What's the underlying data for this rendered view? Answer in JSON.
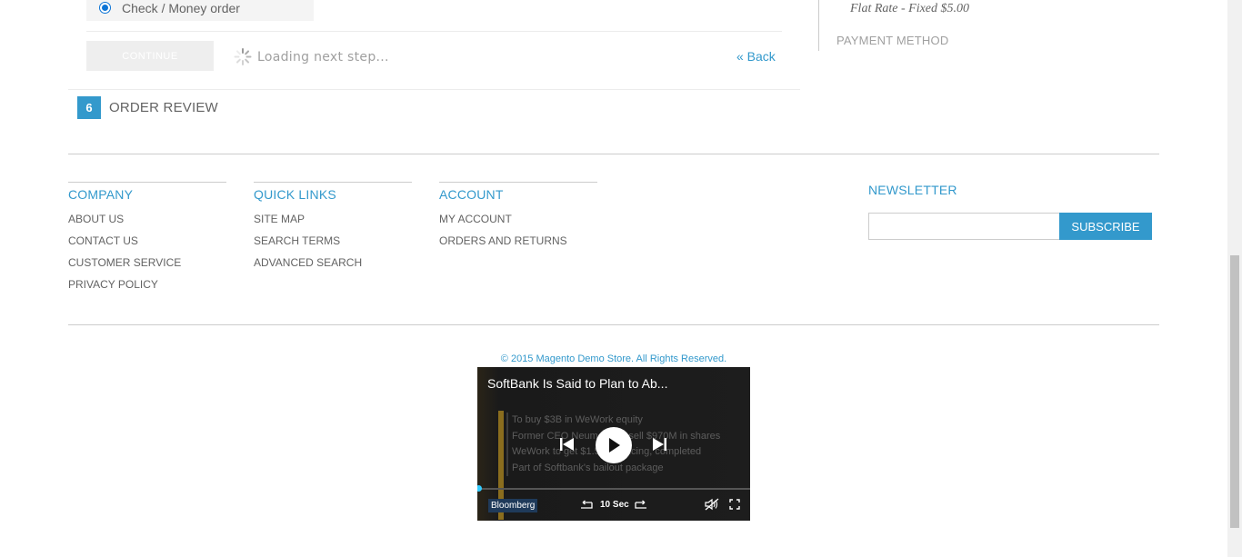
{
  "checkout": {
    "payment_option_label": "Check / Money order",
    "continue_label": "CONTINUE",
    "loading_text": "Loading next step...",
    "back_label": "« Back",
    "step_number": "6",
    "step_title": "ORDER REVIEW"
  },
  "sidebar": {
    "shipping_rate": "Flat Rate - Fixed $5.00",
    "payment_method_heading": "PAYMENT METHOD"
  },
  "footer": {
    "company": {
      "heading": "COMPANY",
      "links": [
        "ABOUT US",
        "CONTACT US",
        "CUSTOMER SERVICE",
        "PRIVACY POLICY"
      ]
    },
    "quick_links": {
      "heading": "QUICK LINKS",
      "links": [
        "SITE MAP",
        "SEARCH TERMS",
        "ADVANCED SEARCH"
      ]
    },
    "account": {
      "heading": "ACCOUNT",
      "links": [
        "MY ACCOUNT",
        "ORDERS AND RETURNS"
      ]
    },
    "newsletter": {
      "heading": "NEWSLETTER",
      "input_value": "",
      "subscribe_label": "SUBSCRIBE"
    },
    "copyright": "© 2015 Magento Demo Store. All Rights Reserved."
  },
  "video": {
    "title": "SoftBank Is Said to Plan to Ab...",
    "lines": [
      "To buy $3B in WeWork equity",
      "Former CEO Neumann to sell $970M in shares",
      "WeWork to get $1.5B financing, completed",
      "Part of Softbank's bailout package"
    ],
    "brand": "Bloomberg",
    "skip_label": "10 Sec",
    "progress": 0.0
  },
  "colors": {
    "accent": "#3399cc",
    "text": "#636363",
    "muted": "#a0a0a0"
  }
}
